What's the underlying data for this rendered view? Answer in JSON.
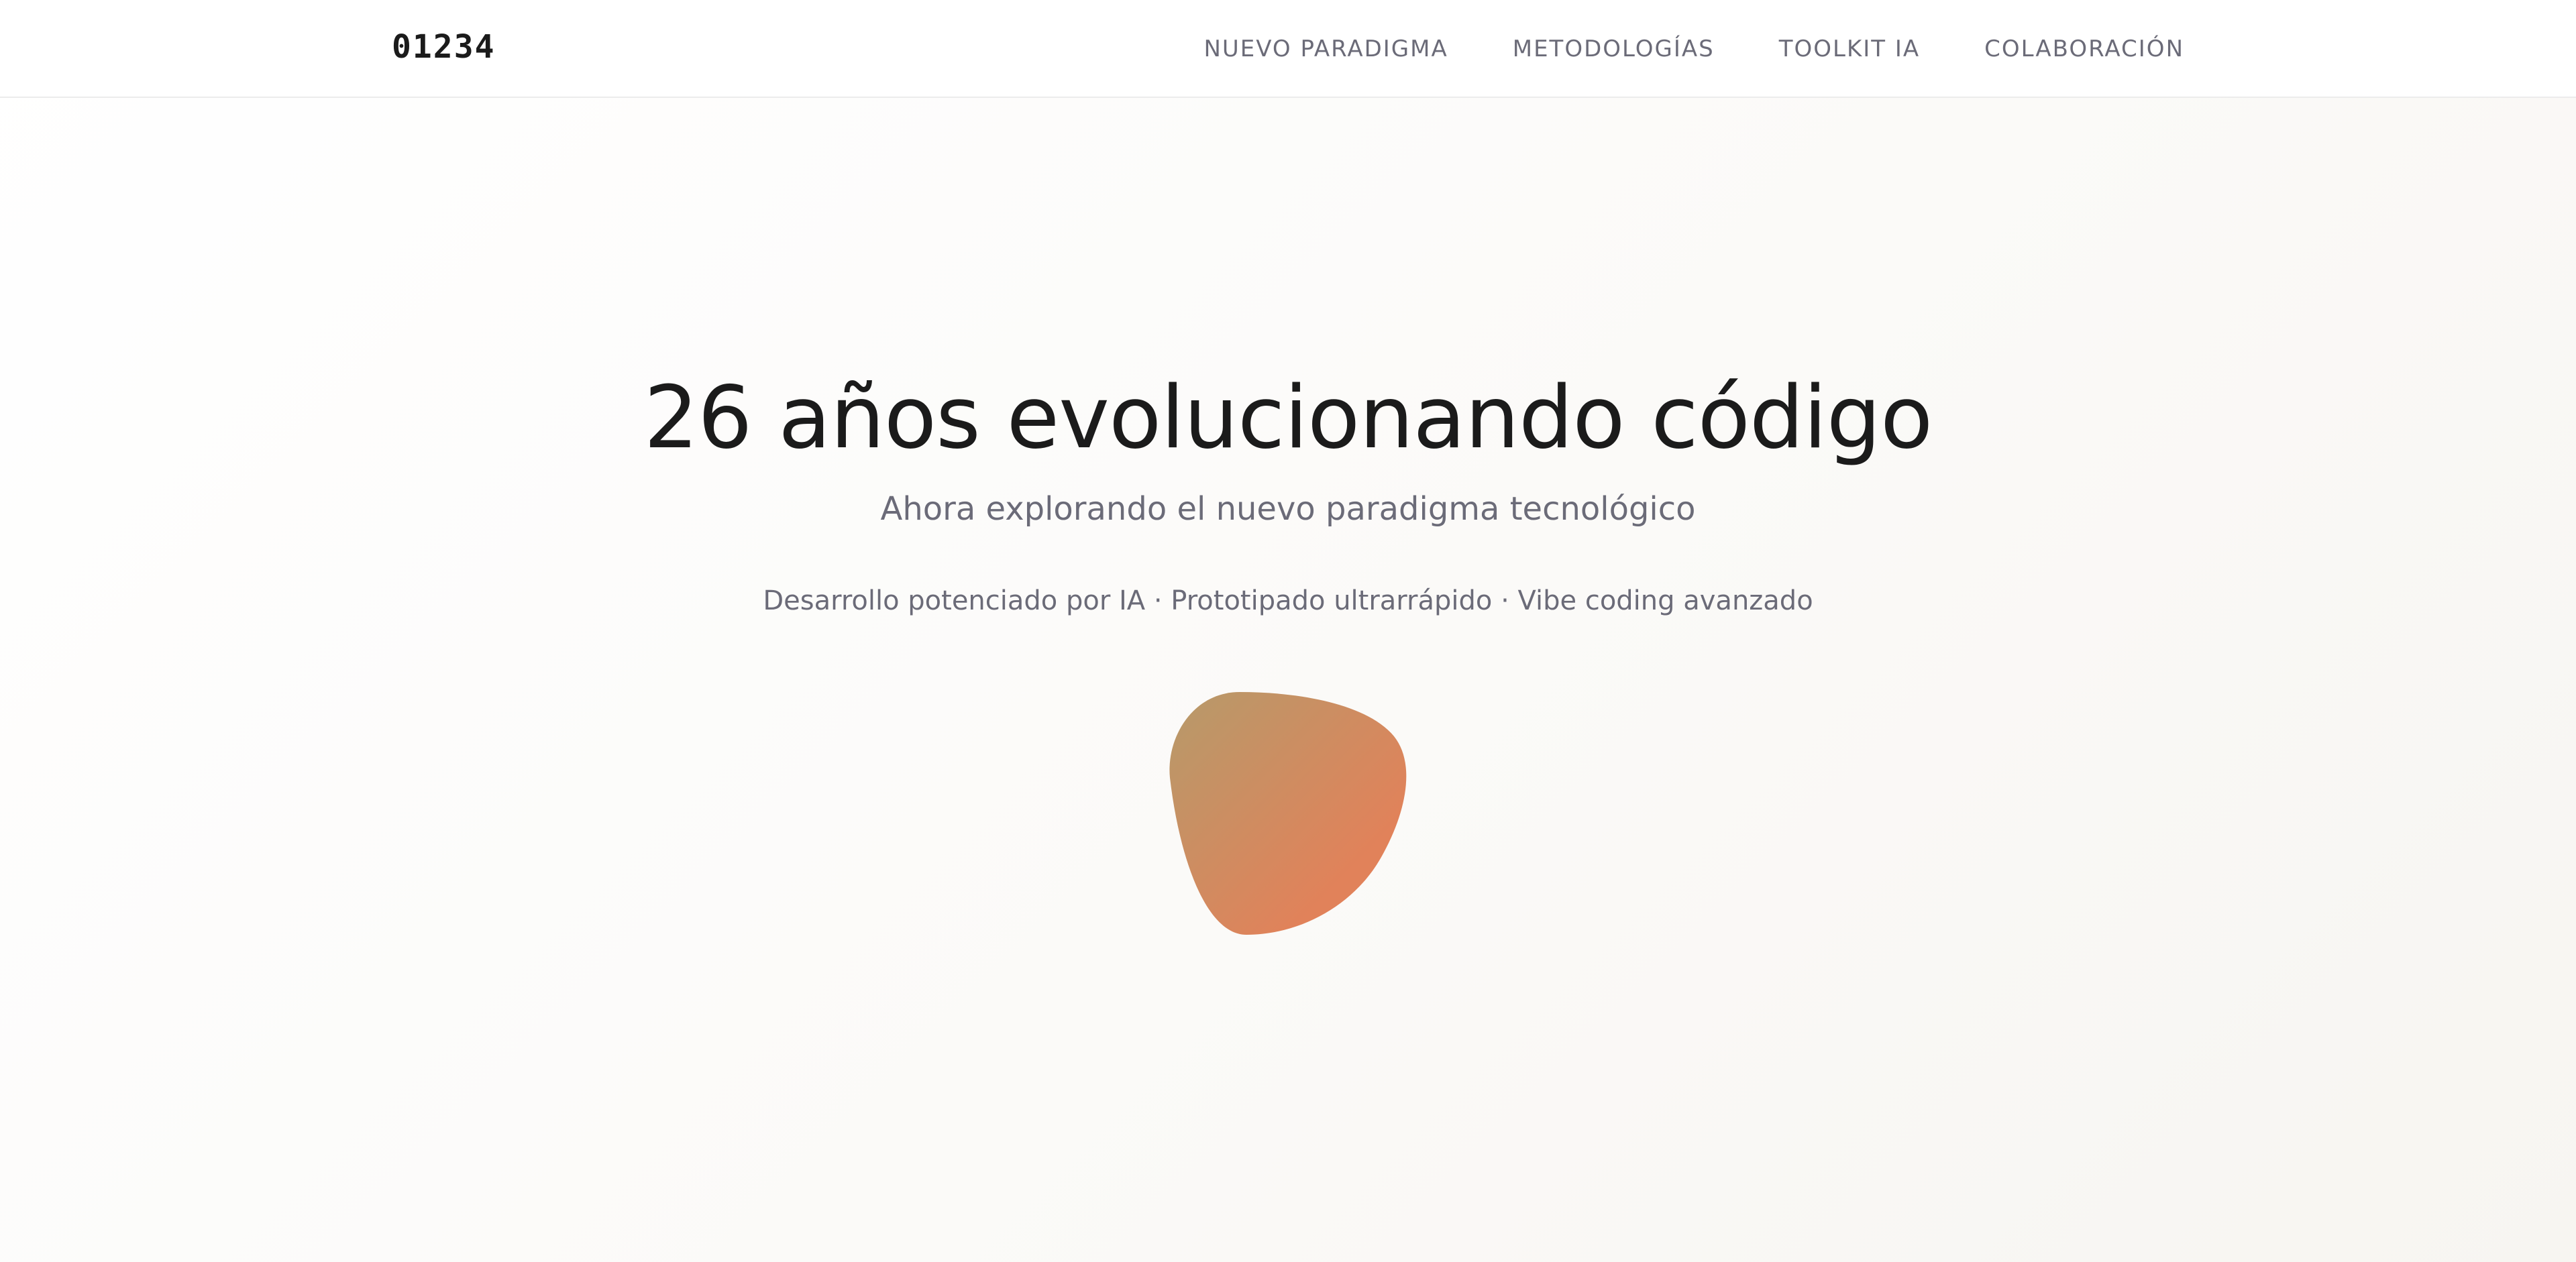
{
  "header": {
    "logo": "01234",
    "nav": [
      {
        "label": "NUEVO PARADIGMA"
      },
      {
        "label": "METODOLOGÍAS"
      },
      {
        "label": "TOOLKIT IA"
      },
      {
        "label": "COLABORACIÓN"
      }
    ]
  },
  "hero": {
    "title": "26 años evolucionando código",
    "subtitle": "Ahora explorando el nuevo paradigma tecnológico",
    "tagline": "Desarrollo potenciado por IA · Prototipado ultrarrápido · Vibe coding avanzado"
  },
  "colors": {
    "blob_gradient_start": "#b69a6a",
    "blob_gradient_end": "#e1825a",
    "text_primary": "#1b1b1b",
    "text_secondary": "#6b6b78"
  }
}
